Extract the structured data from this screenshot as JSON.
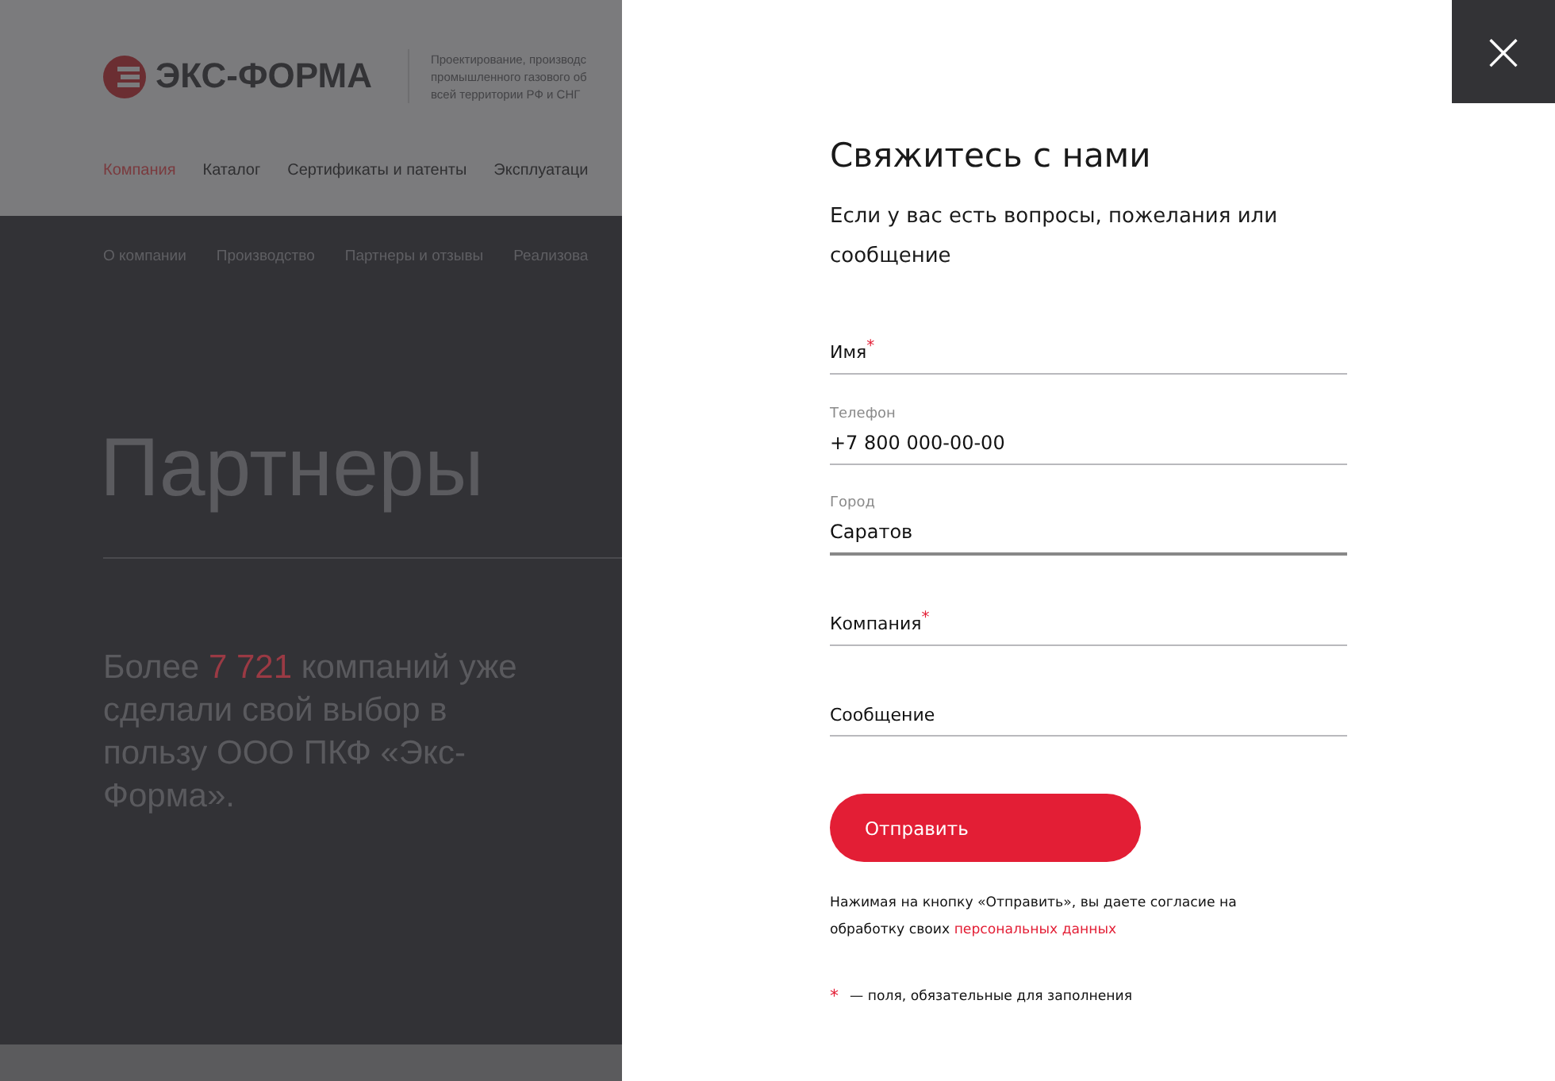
{
  "background_page": {
    "logo": {
      "text": "ЭКС-ФОРМА"
    },
    "tagline": [
      "Проектирование, производс",
      "промышленного газового об",
      "всей территории РФ и СНГ"
    ],
    "nav": [
      {
        "label": "Компания",
        "selected": true
      },
      {
        "label": "Каталог",
        "selected": false
      },
      {
        "label": "Сертификаты и патенты",
        "selected": false
      },
      {
        "label": "Эксплуатаци",
        "selected": false
      }
    ],
    "subnav": [
      {
        "label": "О компании"
      },
      {
        "label": "Производство"
      },
      {
        "label": "Партнеры и отзывы"
      },
      {
        "label": "Реализова"
      }
    ],
    "title": "Партнеры",
    "lead": "Более *7 721* компаний уже сделали свой выбор в пользу ООО ПКФ «Экс-Форма»."
  },
  "dialog": {
    "close": "×",
    "title": "Свяжитесь с нами",
    "subtitle": "Если у вас есть вопросы, пожелания или сообщение",
    "fields": [
      {
        "label": "Имя",
        "required": true,
        "focused": false
      },
      {
        "label": "Телефон",
        "required": false,
        "value": "+7 800 000-00-00",
        "focused": false
      },
      {
        "label": "Город",
        "required": false,
        "value": "Саратов",
        "focused": true
      },
      {
        "label": "Компания",
        "required": true,
        "focused": false
      },
      {
        "label": "Сообщение",
        "required": false,
        "focused": false
      }
    ],
    "submit": "Отправить",
    "consent": {
      "text": "Нажимая на кнопку «Отправить», вы даете согласие на обработку своих",
      "link": "персональных данных"
    },
    "footnote": {
      "mark": "*",
      "text": "— поля, обязательные для заполнения"
    }
  }
}
